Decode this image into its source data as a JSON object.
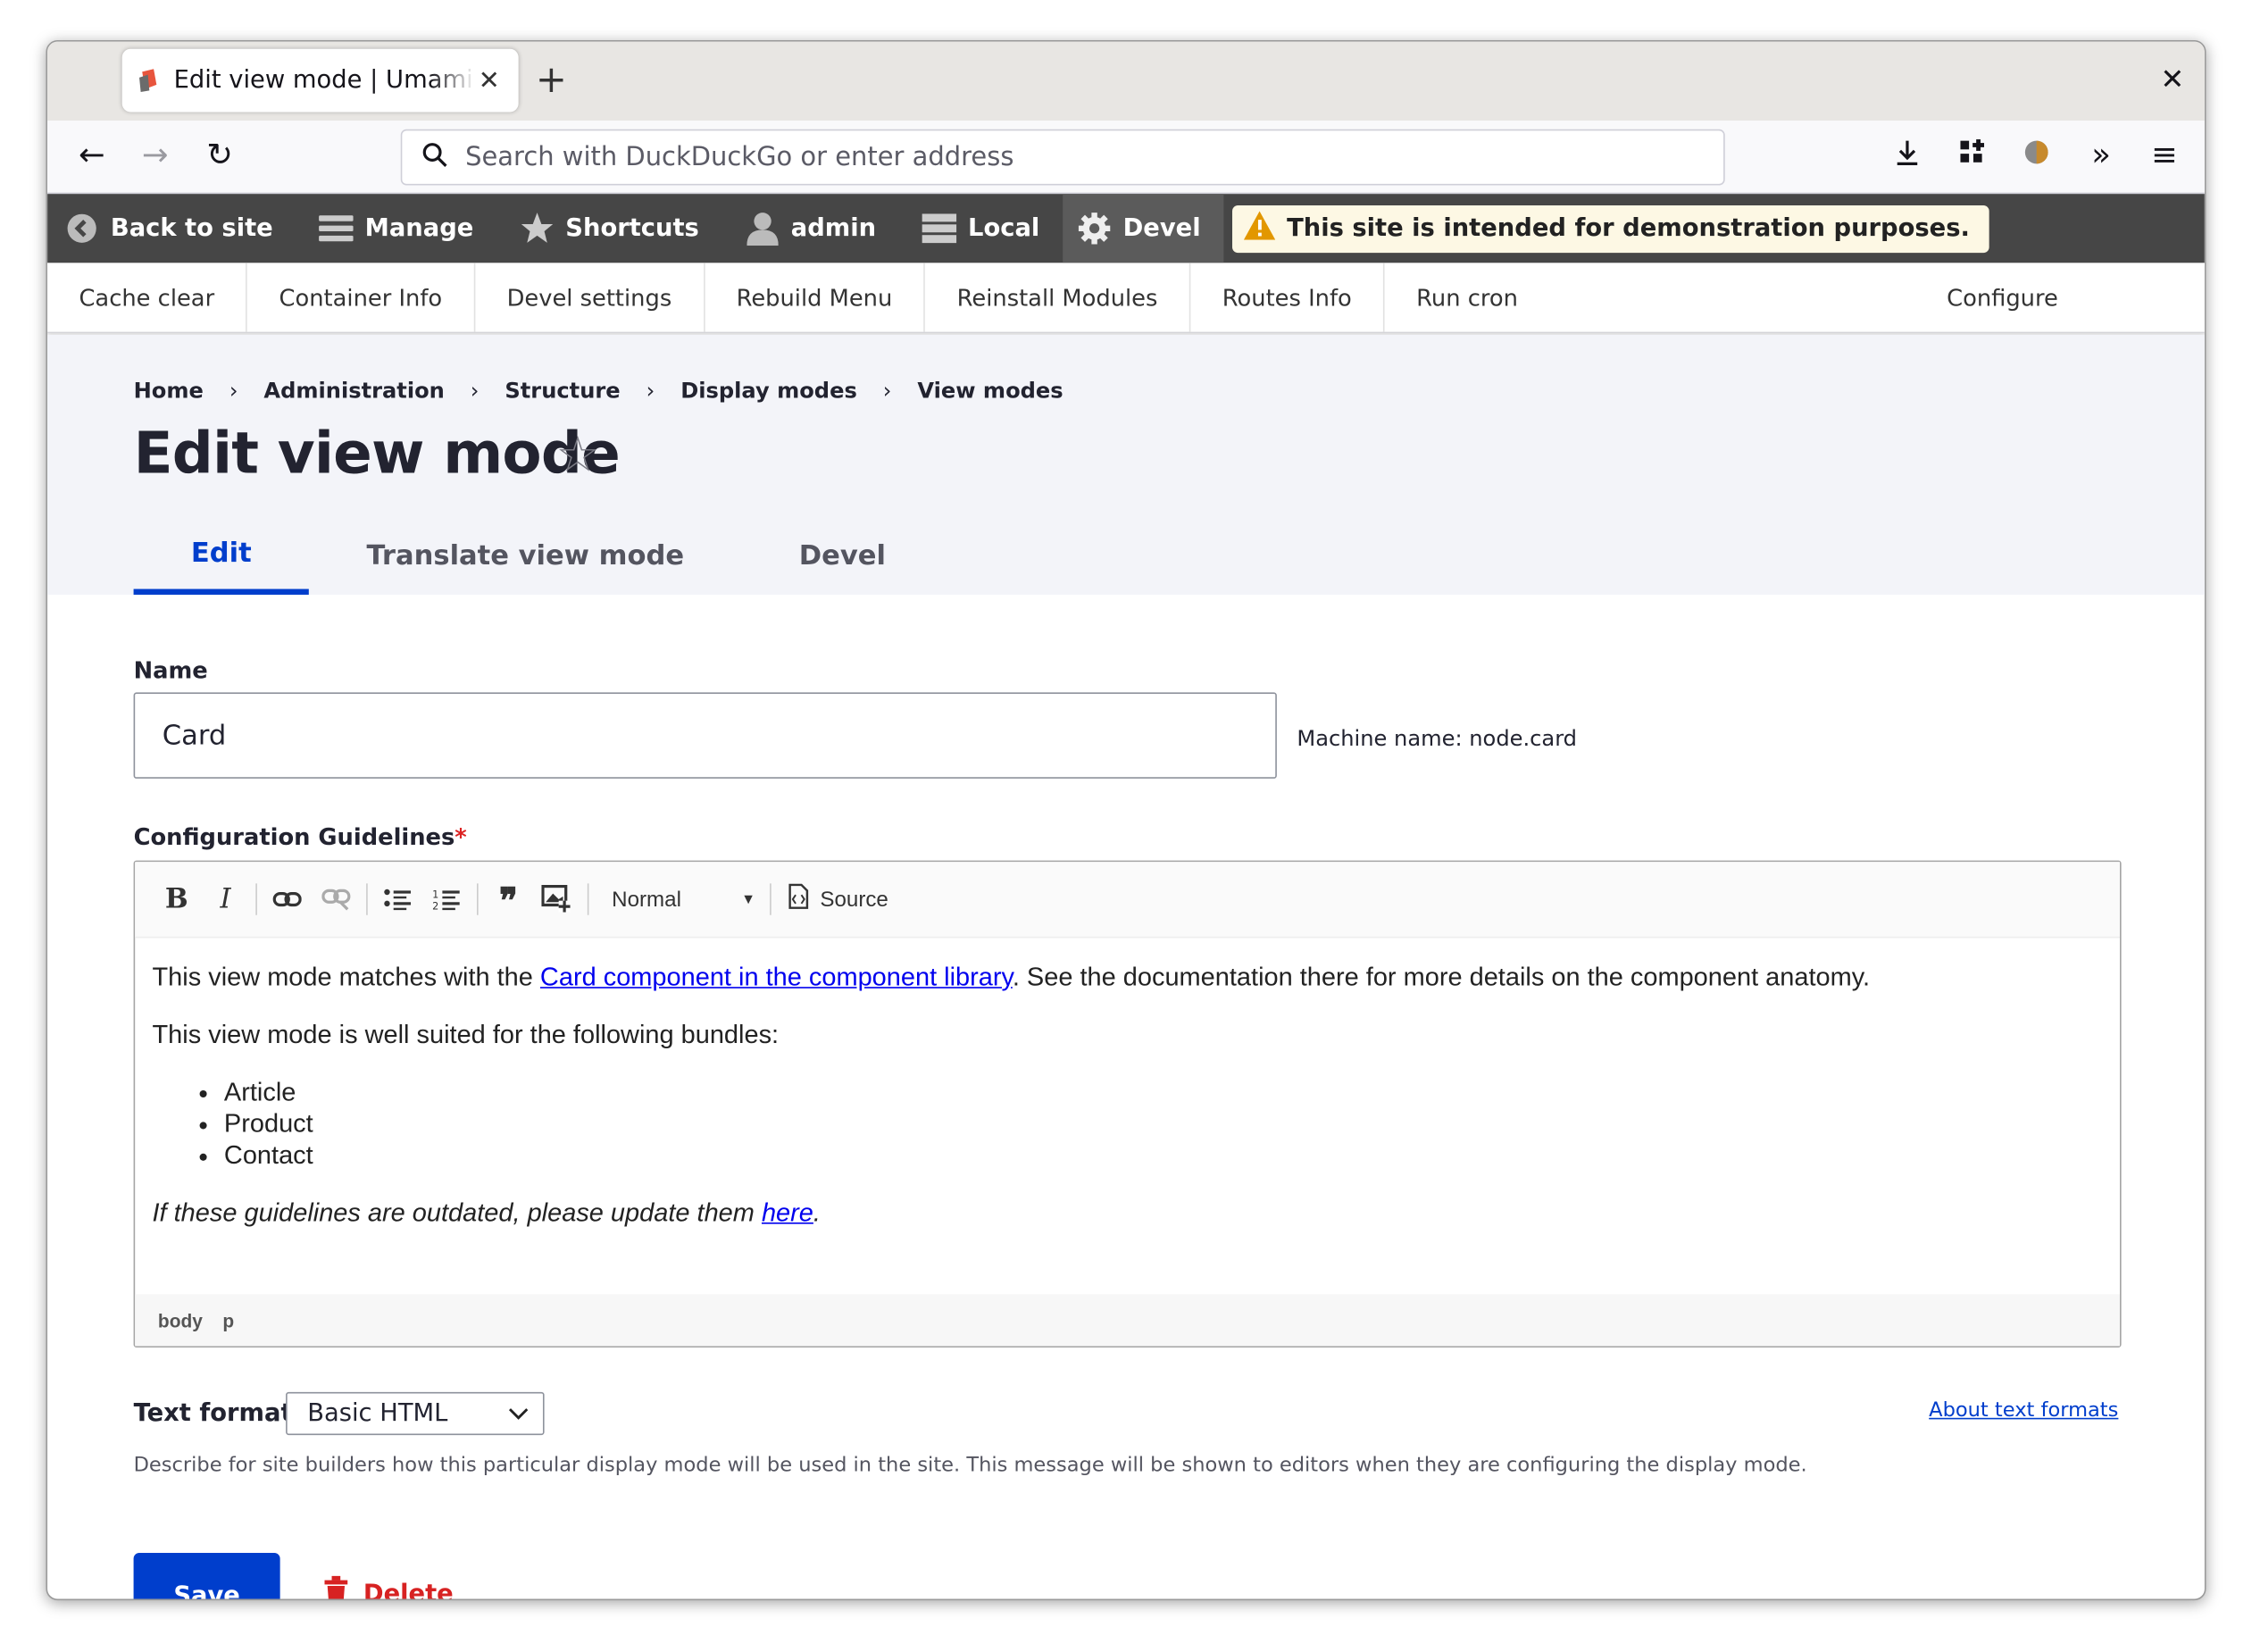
{
  "browser": {
    "tab_title": "Edit view mode | Umami Food Magazine",
    "url_placeholder": "Search with DuckDuckGo or enter address"
  },
  "toolbar": {
    "back_to_site": "Back to site",
    "manage": "Manage",
    "shortcuts": "Shortcuts",
    "user": "admin",
    "local": "Local",
    "devel": "Devel",
    "demo_notice": "This site is intended for demonstration purposes."
  },
  "devel_menu": {
    "items": [
      "Cache clear",
      "Container Info",
      "Devel settings",
      "Rebuild Menu",
      "Reinstall Modules",
      "Routes Info",
      "Run cron"
    ],
    "configure": "Configure"
  },
  "breadcrumb": [
    "Home",
    "Administration",
    "Structure",
    "Display modes",
    "View modes"
  ],
  "page": {
    "title": "Edit view mode",
    "tabs": [
      "Edit",
      "Translate view mode",
      "Devel"
    ]
  },
  "form": {
    "name_label": "Name",
    "name_value": "Card",
    "machine_name": "Machine name: node.card",
    "guidelines_label": "Configuration Guidelines",
    "required_mark": "*",
    "editor": {
      "heading_option": "Normal",
      "source_label": "Source",
      "p1_before": "This view mode matches with the ",
      "p1_link": "Card component in the component library",
      "p1_after": ". See the documentation there for more details on the component anatomy.",
      "p2": "This view mode is well suited for the following bundles:",
      "bundles": [
        "Article",
        "Product",
        "Contact"
      ],
      "p3_before": "If these guidelines are outdated, please update them ",
      "p3_link": "here",
      "p3_after": ".",
      "path": [
        "body",
        "p"
      ]
    },
    "text_format_label": "Text format",
    "text_format_value": "Basic HTML",
    "about_text_formats": "About text formats",
    "description": "Describe for site builders how this particular display mode will be used in the site. This message will be shown to editors when they are configuring the display mode.",
    "save": "Save",
    "delete": "Delete"
  },
  "colors": {
    "accent": "#003ecc",
    "toolbar_bg": "#464646",
    "danger": "#d72222"
  }
}
